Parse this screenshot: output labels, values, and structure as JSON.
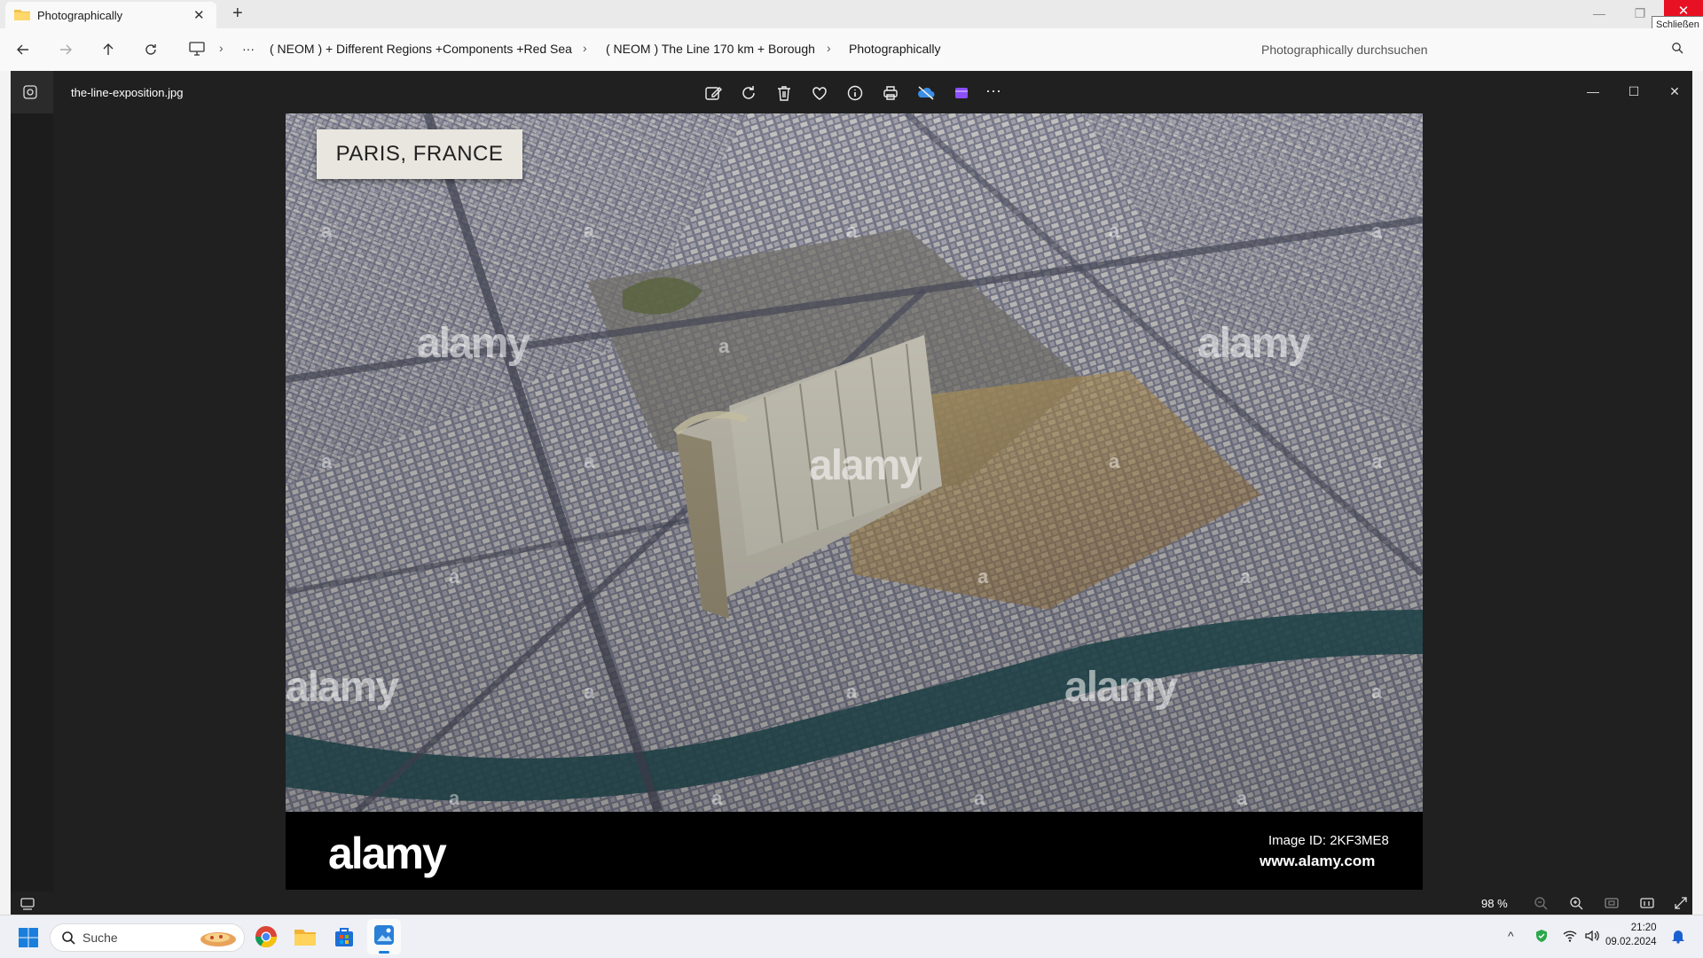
{
  "explorer": {
    "tab_title": "Photographically",
    "tab_close": "✕",
    "new_tab": "+",
    "tooltip": "Schließen",
    "breadcrumbs": [
      "( NEOM ) + Different Regions +Components +Red Sea",
      "( NEOM ) The Line 170 km + Borough",
      "Photographically"
    ],
    "overflow": "···",
    "search_placeholder": "Photographically durchsuchen"
  },
  "viewer": {
    "filename": "the-line-exposition.jpg",
    "toolbar_icons": [
      "edit-icon",
      "rotate-icon",
      "delete-icon",
      "favorite-icon",
      "info-icon",
      "print-icon",
      "onedrive-icon",
      "clipchamp-icon",
      "more-icon"
    ],
    "more": "···",
    "zoom": "98 %"
  },
  "photo": {
    "sign_text": "PARIS, FRANCE",
    "watermark": "alamy",
    "watermark_mark": "a",
    "footer_logo": "alamy",
    "image_id": "Image ID: 2KF3ME8",
    "url": "www.alamy.com"
  },
  "taskbar": {
    "search_label": "Suche",
    "time": "21:20",
    "date": "09.02.2024"
  },
  "colors": {
    "close_red": "#e81123",
    "viewer_bg": "#202020",
    "taskbar_bg": "#eef0f5"
  }
}
